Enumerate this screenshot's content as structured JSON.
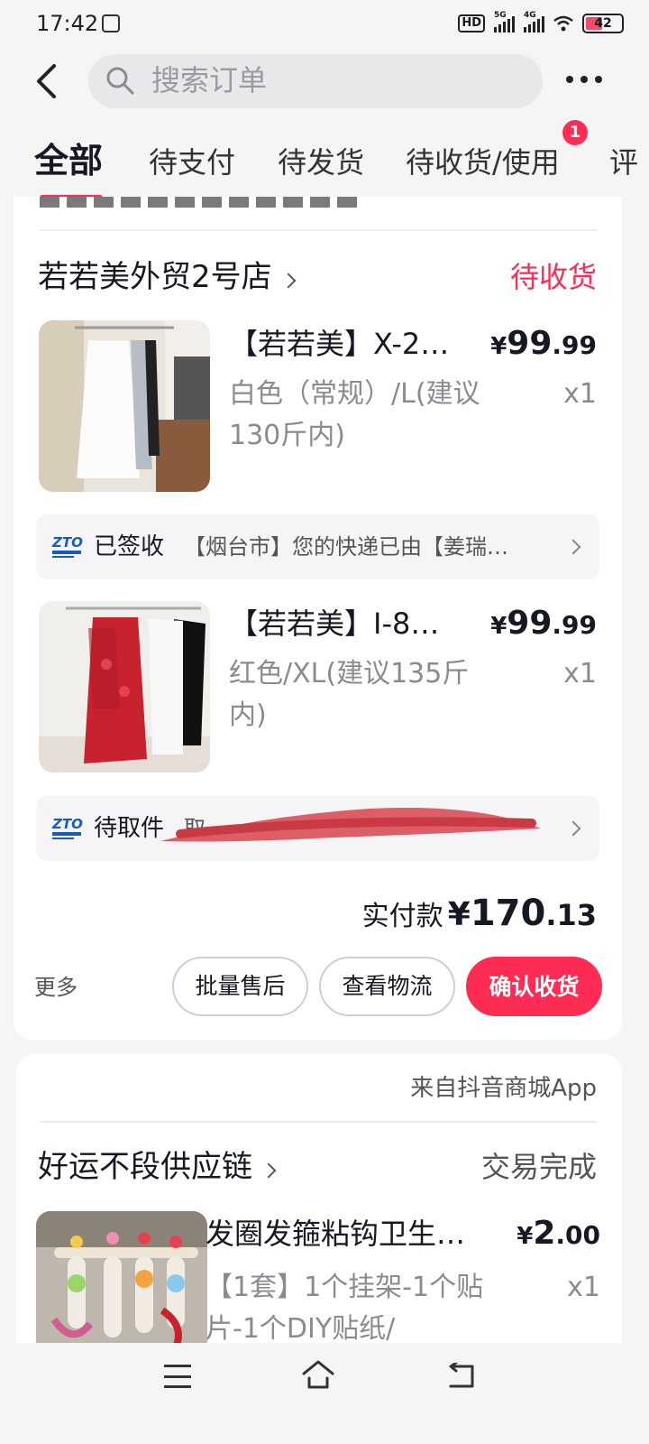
{
  "status_bar": {
    "time": "17:42",
    "hd_badge": "HD",
    "sim1_network": "5G",
    "sim2_network": "4G",
    "battery_level": "42"
  },
  "header": {
    "search_placeholder": "搜索订单"
  },
  "tabs": [
    {
      "label": "全部",
      "active": true
    },
    {
      "label": "待支付",
      "active": false
    },
    {
      "label": "待发货",
      "active": false
    },
    {
      "label": "待收货/使用",
      "active": false,
      "badge": "1"
    },
    {
      "label": "评",
      "active": false
    }
  ],
  "orders": [
    {
      "shop_name": "若若美外贸2号店",
      "status": "待收货",
      "items": [
        {
          "title": "【若若美】X-2…",
          "spec": "白色（常规）/L(建议130斤内)",
          "price_symbol": "¥",
          "price_int": "99",
          "price_dec": ".99",
          "qty": "x1",
          "logistics": {
            "carrier_icon": "zto-express-icon",
            "status": "已签收",
            "detail": "【烟台市】您的快递已由【姜瑞…"
          }
        },
        {
          "title": "【若若美】I-8…",
          "spec": "红色/XL(建议135斤内)",
          "price_symbol": "¥",
          "price_int": "99",
          "price_dec": ".99",
          "qty": "x1",
          "logistics": {
            "carrier_icon": "zto-express-icon",
            "status": "待取件",
            "detail": "取"
          }
        }
      ],
      "paid_label": "实付款",
      "paid_symbol": "¥",
      "paid_int": "170",
      "paid_dec": ".13",
      "more_label": "更多",
      "actions": [
        "批量售后",
        "查看物流",
        "确认收货"
      ]
    },
    {
      "source": "来自抖音商城App",
      "shop_name": "好运不段供应链",
      "status": "交易完成",
      "items": [
        {
          "title": "发圈发箍粘钩卫生…",
          "spec": "【1套】1个挂架-1个贴片-1个DIY贴纸/",
          "price_symbol": "¥",
          "price_int": "2",
          "price_dec": ".00",
          "qty": "x1"
        }
      ]
    }
  ],
  "colors": {
    "accent": "#fe2c55",
    "text_primary": "#161823",
    "text_secondary": "#8a8b91",
    "background": "#f5f5f5"
  },
  "icons": {
    "back": "chevron-left-icon",
    "search": "search-icon",
    "more": "more-dots-icon",
    "nav_menu": "menu-icon",
    "nav_home": "home-icon",
    "nav_back": "back-icon"
  }
}
